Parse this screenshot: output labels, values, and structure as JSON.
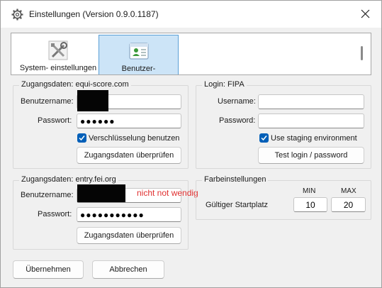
{
  "window": {
    "title": "Einstellungen (Version 0.9.0.1187)",
    "icon": "gear-icon",
    "close_icon": "close-icon"
  },
  "nav": {
    "items": [
      {
        "label": "System- einstellungen",
        "icon": "tools-icon",
        "selected": false
      },
      {
        "label": "Benutzer-",
        "icon": "user-settings-icon",
        "selected": true
      }
    ]
  },
  "equi": {
    "title": "Zugangsdaten: equi-score.com",
    "username_label": "Benutzername:",
    "password_label": "Passwort:",
    "password_value": "●●●●●●",
    "encryption_label": "Verschlüsselung benutzen",
    "encryption_checked": true,
    "check_button": "Zugangsdaten überprüfen"
  },
  "fipa": {
    "title": "Login: FIPA",
    "username_label": "Username:",
    "password_label": "Password:",
    "staging_label": "Use staging environment",
    "staging_checked": true,
    "test_button": "Test login / password"
  },
  "fei": {
    "title": "Zugangsdaten: entry.fei.org",
    "username_label": "Benutzername:",
    "password_label": "Passwort:",
    "password_value": "●●●●●●●●●●●",
    "annotation": "nicht not wendig",
    "check_button": "Zugangsdaten überprüfen"
  },
  "colors": {
    "title": "Farbeinstellungen",
    "min_label": "MIN",
    "max_label": "MAX",
    "start_label": "Gültiger Startplatz",
    "min_value": "10",
    "max_value": "20"
  },
  "footer": {
    "apply": "Übernehmen",
    "cancel": "Abbrechen"
  },
  "accent": "#005fb8",
  "annotation_color": "#e03030"
}
